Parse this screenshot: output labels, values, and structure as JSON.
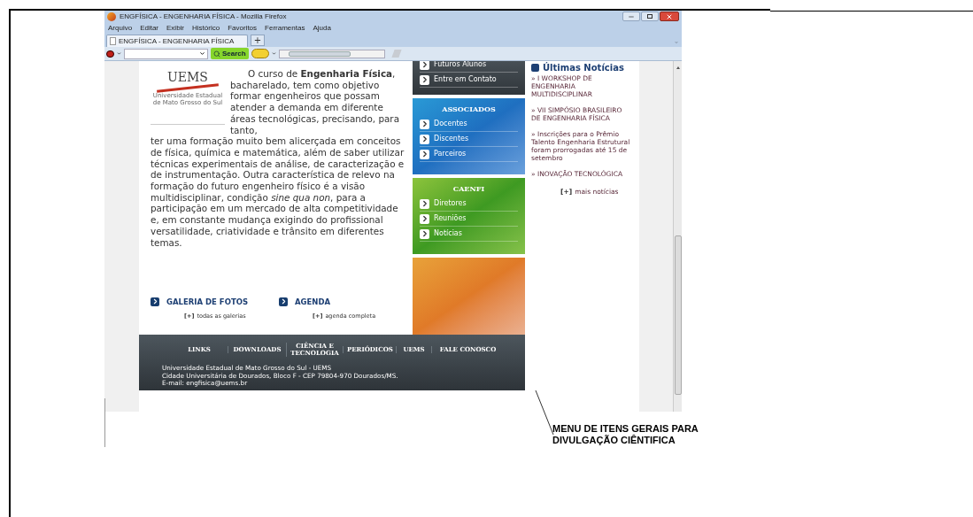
{
  "window": {
    "title": "ENGFÍSICA - ENGENHARIA FÍSICA - Mozilla Firefox"
  },
  "menubar": [
    "Arquivo",
    "Editar",
    "Exibir",
    "Histórico",
    "Favoritos",
    "Ferramentas",
    "Ajuda"
  ],
  "tabs": [
    {
      "label": "ENGFÍSICA - ENGENHARIA FÍSICA",
      "selected": true
    }
  ],
  "new_tab_button": "+",
  "toolbar": {
    "search_button": "Search"
  },
  "page": {
    "logo": {
      "text": "UEMS",
      "subtitle": "Universidade Estadual de Mato Grosso do Sul"
    },
    "intro_top": "O curso de **Engenharia Física**, bacharelado, tem como objetivo formar engenheiros que possam atender a demanda em diferente áreas tecnológicas, precisando, para tanto,",
    "intro": "ter uma formação muito bem alicerçada em conceitos de física, química e matemática, além de saber utilizar técnicas experimentais de análise, de caracterização e de instrumentação. Outra característica de relevo na formação do futuro engenheiro físico é a visão multidisciplinar, condição *sine qua non*, para a participação em um mercado de alta competitividade e, em constante mudança exigindo do profissional versatilidade, criatividade e trânsito em diferentes temas.",
    "sections": [
      {
        "title": "GALERIA DE FOTOS",
        "marker": "[+]",
        "link": "todas as galerias"
      },
      {
        "title": "AGENDA",
        "marker": "[+]",
        "link": "agenda completa"
      }
    ],
    "side_panels": [
      {
        "kind": "dark",
        "items": [
          "Futuros Alunos",
          "Entre em Contato"
        ]
      },
      {
        "kind": "blue",
        "title": "ASSOCIADOS",
        "items": [
          "Docentes",
          "Discentes",
          "Parceiros"
        ]
      },
      {
        "kind": "green",
        "title": "CAENFI",
        "items": [
          "Diretores",
          "Reuniões",
          "Notícias"
        ]
      },
      {
        "kind": "orange"
      }
    ],
    "news": {
      "title": "Últimas Notícias",
      "items": [
        "» I  WORKSHOP DE ENGENHARIA MULTIDISCIPLINAR",
        "» VII SIMPÓSIO BRASILEIRO DE ENGENHARIA FÍSICA",
        "» Inscrições para o Prêmio Talento Engenharia Estrutural foram prorrogadas até 15 de setembro",
        "» INOVAÇÃO TECNOLÓGICA"
      ],
      "more_marker": "[+]",
      "more_link": "mais notícias"
    },
    "footer": {
      "nav": [
        "LINKS",
        "DOWNLOADS",
        "CIÊNCIA E TECNOLOGIA",
        "PERIÓDICOS",
        "UEMS",
        "FALE CONOSCO"
      ],
      "address": [
        "Universidade Estadual de Mato Grosso do Sul - UEMS",
        "Cidade Universitária de Dourados, Bloco F - CEP  79804-970 Dourados/MS.",
        "E-mail: engfisica@uems.br"
      ]
    }
  },
  "annotation": "MENU DE ITENS GERAIS PARA DIVULGAÇÃO CIÊNTIFICA"
}
